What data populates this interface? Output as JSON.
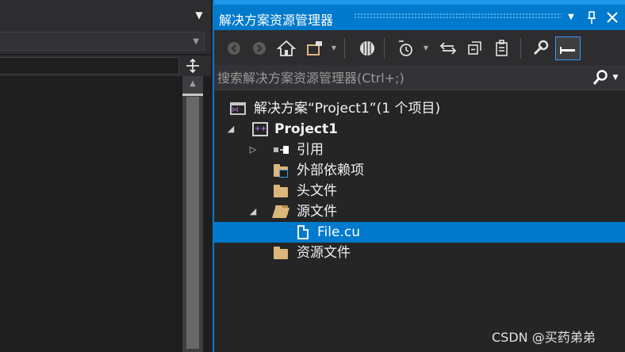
{
  "solution_explorer": {
    "title": "解决方案资源管理器",
    "search_placeholder": "搜索解决方案资源管理器(Ctrl+;)",
    "tree": {
      "solution": "解决方案“Project1”(1 个项目)",
      "project": "Project1",
      "references": "引用",
      "external_deps": "外部依赖项",
      "header_files": "头文件",
      "source_files": "源文件",
      "file_cu": "File.cu",
      "resource_files": "资源文件"
    }
  },
  "watermark": "CSDN @买药弟弟",
  "colors": {
    "accent": "#007acc",
    "background": "#1e1e1e",
    "panel": "#252526",
    "folder": "#dcb67a"
  }
}
